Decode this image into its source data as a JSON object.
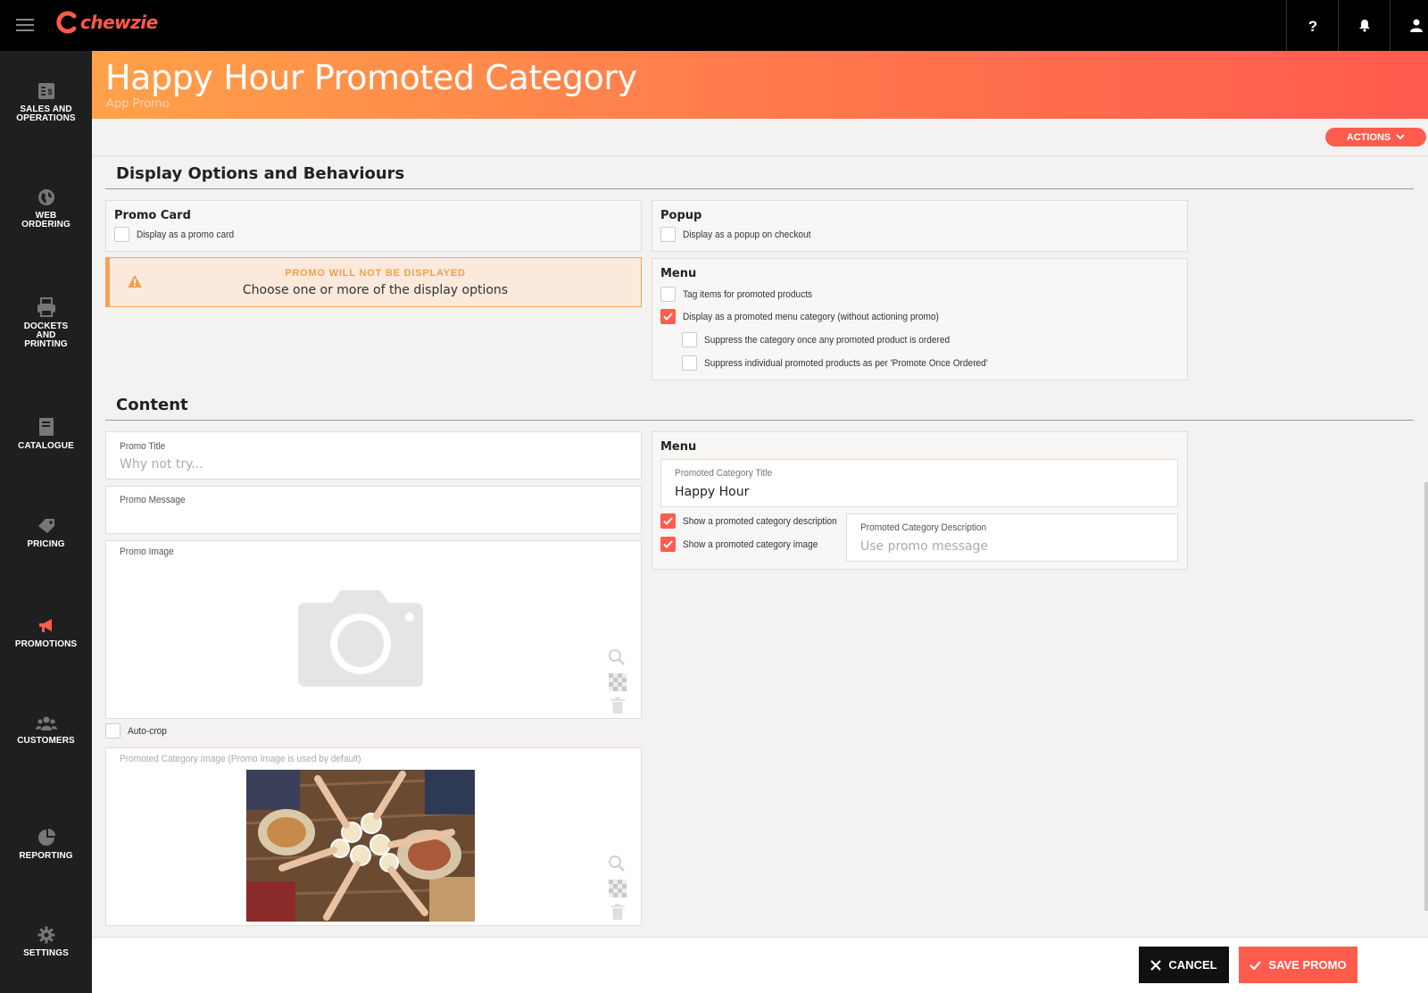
{
  "app": {
    "brand": "chewzie"
  },
  "topbar": {
    "help_icon": "question-icon",
    "notifications_icon": "bell-icon",
    "user_icon": "user-icon"
  },
  "sidebar": {
    "items": [
      {
        "label": "SALES AND OPERATIONS",
        "icon": "receipt-icon"
      },
      {
        "label": "WEB ORDERING",
        "icon": "globe-icon"
      },
      {
        "label": "DOCKETS AND PRINTING",
        "icon": "printer-icon"
      },
      {
        "label": "CATALOGUE",
        "icon": "book-icon"
      },
      {
        "label": "PRICING",
        "icon": "price-tag-icon"
      },
      {
        "label": "PROMOTIONS",
        "icon": "megaphone-icon",
        "active": true
      },
      {
        "label": "CUSTOMERS",
        "icon": "users-icon"
      },
      {
        "label": "REPORTING",
        "icon": "pie-chart-icon"
      },
      {
        "label": "SETTINGS",
        "icon": "gear-icon"
      }
    ]
  },
  "header": {
    "title": "Happy Hour Promoted Category",
    "subtitle": "App Promo"
  },
  "toolbar": {
    "actions_label": "ACTIONS"
  },
  "display_options": {
    "title": "Display Options and Behaviours",
    "promo_card": {
      "title": "Promo Card",
      "option": "Display as a promo card",
      "checked": false
    },
    "popup": {
      "title": "Popup",
      "option": "Display as a popup on checkout",
      "checked": false
    },
    "warning": {
      "title": "PROMO WILL NOT BE DISPLAYED",
      "message": "Choose one or more of the display options"
    },
    "menu": {
      "title": "Menu",
      "options": [
        {
          "label": "Tag items for promoted products",
          "checked": false
        },
        {
          "label": "Display as a promoted menu category (without actioning promo)",
          "checked": true
        },
        {
          "label": "Suppress the category once any promoted product is ordered",
          "checked": false
        },
        {
          "label": "Suppress individual promoted products as per 'Promote Once Ordered'",
          "checked": false
        }
      ]
    }
  },
  "content": {
    "title": "Content",
    "promo_title": {
      "label": "Promo Title",
      "placeholder": "Why not try..."
    },
    "promo_message": {
      "label": "Promo Message",
      "value": ""
    },
    "promo_image": {
      "label": "Promo Image"
    },
    "auto_crop": {
      "label": "Auto-crop",
      "checked": false
    },
    "promoted_category_image": {
      "label": "Promoted Category Image (Promo Image is used by default)"
    },
    "menu": {
      "title": "Menu",
      "category_title": {
        "label": "Promoted Category Title",
        "value": "Happy Hour"
      },
      "show_description": {
        "label": "Show a promoted category description",
        "checked": true
      },
      "show_image": {
        "label": "Show a promoted category image",
        "checked": true
      },
      "category_description": {
        "label": "Promoted Category Description",
        "placeholder": "Use promo message"
      }
    }
  },
  "footer": {
    "cancel_label": "CANCEL",
    "save_label": "SAVE PROMO"
  },
  "colors": {
    "accent": "#ff5c4e",
    "sidebar": "#1f1f1f",
    "topbar": "#000000",
    "warning": "#f4a25a"
  }
}
